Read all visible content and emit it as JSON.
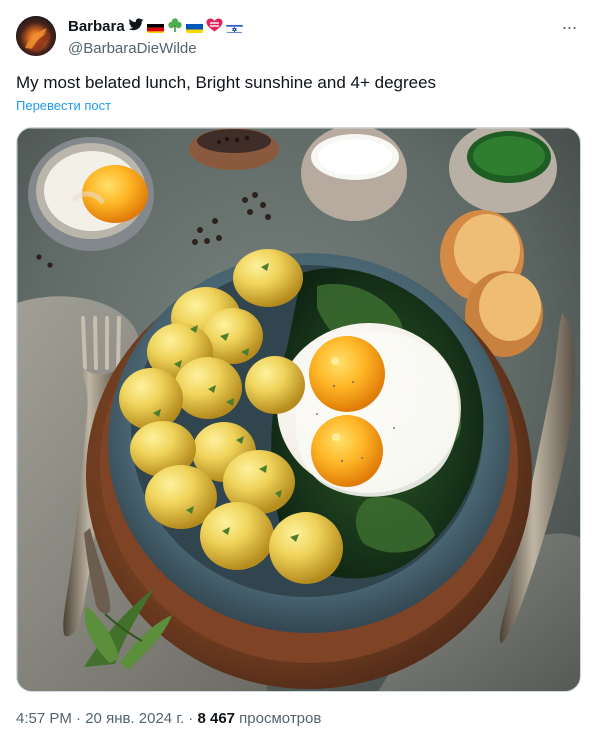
{
  "tweet": {
    "author": {
      "display_name": "Barbara",
      "handle": "@BarbaraDieWilde",
      "badges": [
        "twitter-bird-icon",
        "germany-flag-icon",
        "shamrock-icon",
        "ukraine-flag-icon",
        "heart-badge-icon",
        "israel-flag-icon"
      ]
    },
    "text": "My most belated lunch, Bright sunshine and 4+ degrees",
    "translate_label": "Перевести пост",
    "more_label": "···",
    "media": {
      "alt": "",
      "type": "photo"
    },
    "timestamp": {
      "time": "4:57 PM",
      "separator1": " · ",
      "date": "20 янв. 2024 г.",
      "separator2": " · ",
      "views_count": "8 467",
      "views_label": " просмотров"
    }
  },
  "colors": {
    "link": "#1d9bf0",
    "secondary_text": "#536471",
    "primary_text": "#0f1419",
    "border": "#cfd9de"
  }
}
